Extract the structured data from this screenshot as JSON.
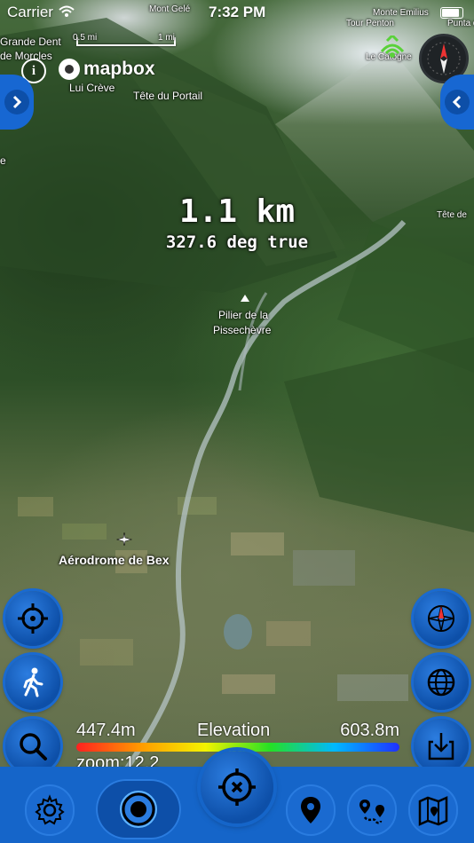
{
  "status_bar": {
    "carrier": "Carrier",
    "time": "7:32 PM"
  },
  "scale_bar": {
    "label_1": "0.5 mi",
    "label_2": "1 mi"
  },
  "branding": {
    "info_symbol": "i",
    "mapbox": "mapbox"
  },
  "map_labels": {
    "mont_gele": "Mont Gelé",
    "mont_emilius": "Monte Emilius",
    "punta_della": "Punta della",
    "tour_penton": "Tour Penton",
    "grande_dent_1": "Grande Dent",
    "grande_dent_2": "de Morcles",
    "lui_creve": "Lui Crève",
    "tete_du_portail": "Tête du Portail",
    "le_catogne": "Le Catogne",
    "tete_de": "Tête de",
    "pilier_1": "Pilier de la",
    "pilier_2": "Pissechèvre",
    "aerodrome": "Aérodrome de Bex",
    "e_label": "e"
  },
  "measure": {
    "distance": "1.1 km",
    "bearing": "327.6 deg true"
  },
  "elevation": {
    "min": "447.4m",
    "title": "Elevation",
    "max": "603.8m",
    "zoom": "zoom:12.2"
  },
  "icons": {
    "compass": "compass-icon",
    "locate": "crosshair-icon",
    "walk": "walking-person-icon",
    "search": "search-icon",
    "compass_rose": "compass-rose-icon",
    "globe": "globe-icon",
    "download": "download-icon",
    "settings": "gear-icon",
    "track": "target-icon",
    "center": "crosshair-x-icon",
    "pin": "map-pin-icon",
    "route": "route-icon",
    "map": "folded-map-icon"
  },
  "colors": {
    "accent": "#1565c9",
    "button": "#0d4fa8",
    "highlight": "#5ad13a"
  }
}
